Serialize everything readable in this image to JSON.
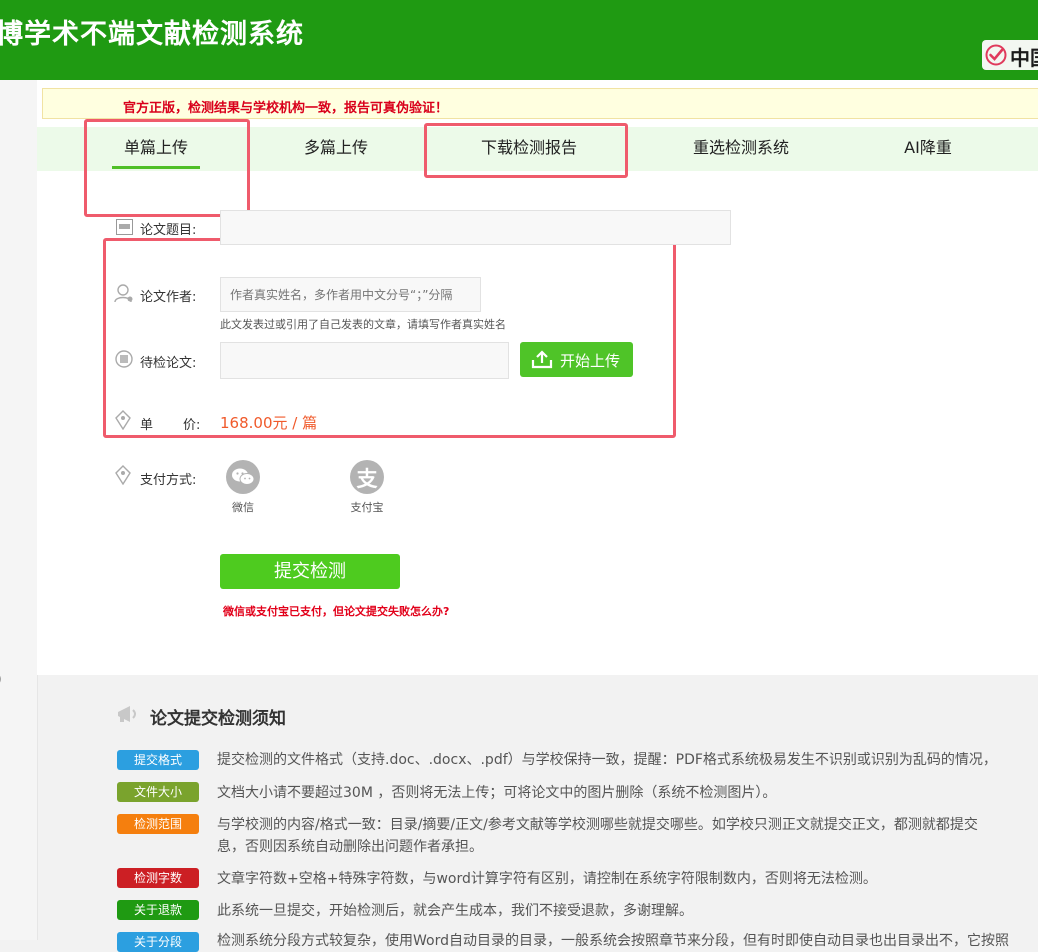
{
  "header": {
    "title": "博学术不端文献检测系统",
    "brand_text": "中国"
  },
  "notice": {
    "text": "官方正版，检测结果与学校机构一致，报告可真伪验证！"
  },
  "tabs": [
    {
      "label": "单篇上传",
      "active": true
    },
    {
      "label": "多篇上传",
      "active": false
    },
    {
      "label": "下载检测报告",
      "active": false
    },
    {
      "label": "重选检测系统",
      "active": false
    },
    {
      "label": "AI降重",
      "active": false
    }
  ],
  "form": {
    "title_label": "论文题目:",
    "title_value": "",
    "author_label": "论文作者:",
    "author_placeholder": "作者真实姓名，多作者用中文分号“；”分隔",
    "author_hint": "此文发表过或引用了自己发表的文章，请填写作者真实姓名",
    "paper_label": "待检论文:",
    "paper_value": "",
    "upload_label": "开始上传",
    "price_label_1": "单",
    "price_label_2": "价:",
    "price_value": "168.00元 / 篇",
    "pay_label": "支付方式:",
    "pay_options": [
      {
        "label": "微信",
        "icon": "wechat-icon"
      },
      {
        "label": "支付宝",
        "icon": "alipay-icon",
        "glyph": "支"
      }
    ],
    "submit_label": "提交检测",
    "fail_link": "微信或支付宝已支付，但论文提交失败怎么办?"
  },
  "notes": {
    "title": "论文提交检测须知",
    "rows": [
      {
        "tag": "提交格式",
        "color": "#2c9fe0",
        "text": "提交检测的文件格式（支持.doc、.docx、.pdf）与学校保持一致，提醒：PDF格式系统极易发生不识别或识别为乱码的情况，"
      },
      {
        "tag": "文件大小",
        "color": "#7aa32d",
        "text": "文档大小请不要超过30M ，否则将无法上传；可将论文中的图片删除（系统不检测图片）。"
      },
      {
        "tag": "检测范围",
        "color": "#f57f0e",
        "text": "与学校测的内容/格式一致：目录/摘要/正文/参考文献等学校测哪些就提交哪些。如学校只测正文就提交正文，都测就都提交",
        "text2": "息，否则因系统自动删除出问题作者承担。"
      },
      {
        "tag": "检测字数",
        "color": "#cc1f24",
        "text": "文章字符数+空格+特殊字符数，与word计算字符有区别，请控制在系统字符限制数内，否则将无法检测。"
      },
      {
        "tag": "关于退款",
        "color": "#1f9a12",
        "text": "此系统一旦提交，开始检测后，就会产生成本，我们不接受退款，多谢理解。"
      },
      {
        "tag": "关于分段",
        "color": "#2c9fe0",
        "text": "检测系统分段方式较复杂，使用Word自动目录的目录，一般系统会按照章节来分段，但有时即使自动目录也出目录出不，它按照"
      }
    ]
  },
  "colors": {
    "header_green": "#1f9a12",
    "accent_green": "#4fc428",
    "price_orange": "#f05a2b",
    "alert_red": "#d9001b",
    "highlight_box": "#ef5b6c"
  }
}
